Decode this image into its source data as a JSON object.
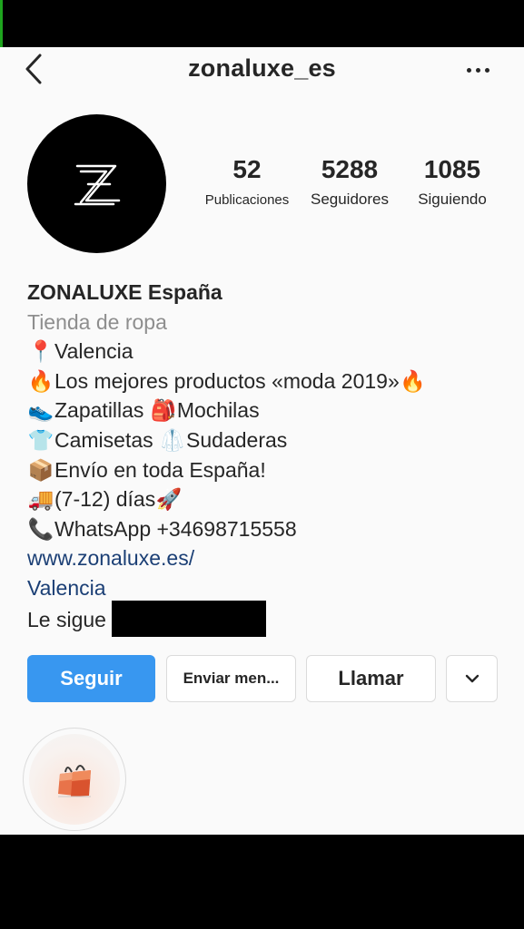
{
  "header": {
    "username": "zonaluxe_es"
  },
  "stats": {
    "posts": {
      "count": "52",
      "label": "Publicaciones"
    },
    "followers": {
      "count": "5288",
      "label": "Seguidores"
    },
    "following": {
      "count": "1085",
      "label": "Siguiendo"
    }
  },
  "bio": {
    "name": "ZONALUXE España",
    "category": "Tienda de ropa",
    "lines": [
      {
        "emoji": "📍",
        "text": "Valencia"
      },
      {
        "emoji": "🔥",
        "text": "Los mejores productos «moda 2019»",
        "emoji_after": "🔥"
      },
      {
        "emoji": "👟",
        "text": "Zapatillas",
        "emoji2": "🎒",
        "text2": "Mochilas"
      },
      {
        "emoji": "👕",
        "text": "Camisetas",
        "emoji2": "🥼",
        "text2": "Sudaderas"
      },
      {
        "emoji": "📦",
        "text": "Envío en toda España!"
      },
      {
        "emoji": "🚚",
        "text": "(7-12) días",
        "emoji_after": "🚀"
      },
      {
        "emoji": "📞",
        "text": "WhatsApp +34698715558"
      }
    ],
    "website": "www.zonaluxe.es/",
    "location_link": "Valencia",
    "followed_by_prefix": "Le sigue"
  },
  "actions": {
    "follow": "Seguir",
    "message": "Enviar men...",
    "call": "Llamar"
  },
  "icons": {
    "back": "chevron-left-icon",
    "more": "more-horizontal-icon",
    "dropdown": "chevron-down-icon",
    "highlight": "shopping-bags-icon"
  },
  "colors": {
    "follow_button": "#3897f0",
    "link": "#1b3f75",
    "category": "#8e8e8e",
    "text": "#262626",
    "background": "#fafafa"
  }
}
